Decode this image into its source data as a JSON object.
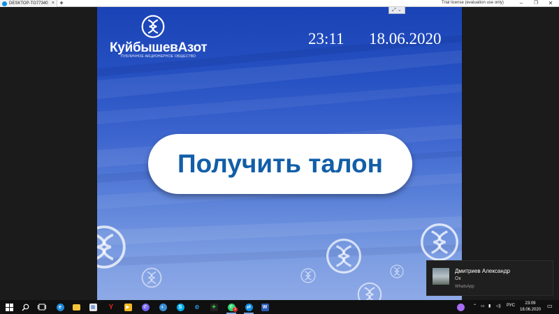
{
  "session_tab": {
    "label": "DESKTOP-TG77340",
    "close": "×",
    "add": "+"
  },
  "license_text": "Trial license (evaluation use only)",
  "window_controls": {
    "minimize": "–",
    "maximize": "❐",
    "close": "✕"
  },
  "kiosk": {
    "collapse_handle": "⤢ ⌄",
    "brand_name": "КуйбышевАзот",
    "brand_subtitle": "ПУБЛИЧНОЕ АКЦИОНЕРНОЕ ОБЩЕСТВО",
    "time": "23:11",
    "date": "18.06.2020",
    "ticket_button": "Получить талон"
  },
  "notification": {
    "sender": "Дмитриев Александр",
    "message": "Ок",
    "app": "WhatsApp"
  },
  "taskbar": {
    "language": "РУС",
    "time": "23:09",
    "date": "18.06.2020",
    "apps": [
      {
        "icon": "windows-start-icon",
        "color": "#ffffff"
      },
      {
        "icon": "search-icon",
        "color": "#ffffff"
      },
      {
        "icon": "task-view-icon",
        "color": "#ffffff"
      },
      {
        "icon": "edge-icon",
        "color": "#1f8ad9"
      },
      {
        "icon": "file-explorer-icon",
        "color": "#f3c33b"
      },
      {
        "icon": "store-icon",
        "color": "#e8e8e8"
      },
      {
        "icon": "yandex-browser-icon",
        "color": "#e52620"
      },
      {
        "icon": "media-player-icon",
        "color": "#f5b820"
      },
      {
        "icon": "viber-icon",
        "color": "#7360f2"
      },
      {
        "icon": "app-icon",
        "color": "#3a8fd8"
      },
      {
        "icon": "skype-icon",
        "color": "#00aff0"
      },
      {
        "icon": "internet-explorer-icon",
        "color": "#2a8fd4"
      },
      {
        "icon": "game-icon",
        "color": "#3ad13a"
      },
      {
        "icon": "whatsapp-icon",
        "color": "#25d366"
      },
      {
        "icon": "teamviewer-icon",
        "color": "#0e8ee9"
      },
      {
        "icon": "word-icon",
        "color": "#2b5cb5"
      }
    ],
    "whatsapp_badge": "1"
  }
}
